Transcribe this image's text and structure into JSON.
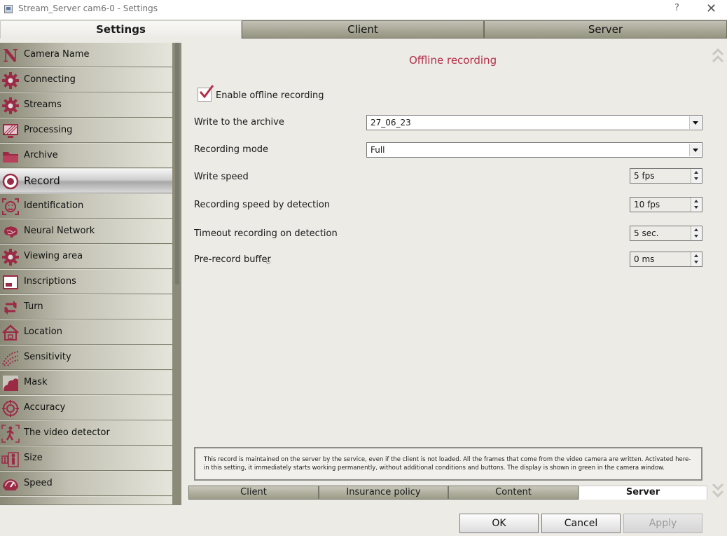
{
  "window": {
    "title": "Stream_Server cam6-0 - Settings",
    "help": "?",
    "close": "✕"
  },
  "top_tabs": [
    {
      "label": "Settings",
      "active": true
    },
    {
      "label": "Client",
      "active": false
    },
    {
      "label": "Server",
      "active": false
    }
  ],
  "sidebar": {
    "items": [
      {
        "label": "Camera Name",
        "icon": "camera-name-icon"
      },
      {
        "label": "Connecting",
        "icon": "gear-icon"
      },
      {
        "label": "Streams",
        "icon": "gear-icon"
      },
      {
        "label": "Processing",
        "icon": "monitor-icon"
      },
      {
        "label": "Archive",
        "icon": "folder-icon"
      },
      {
        "label": "Record",
        "icon": "record-icon",
        "active": true
      },
      {
        "label": "Identification",
        "icon": "face-icon"
      },
      {
        "label": "Neural Network",
        "icon": "brain-icon"
      },
      {
        "label": "Viewing area",
        "icon": "gear-icon"
      },
      {
        "label": "Inscriptions",
        "icon": "inscription-icon"
      },
      {
        "label": "Turn",
        "icon": "rotate-icon"
      },
      {
        "label": "Location",
        "icon": "house-icon"
      },
      {
        "label": "Sensitivity",
        "icon": "sensitivity-icon"
      },
      {
        "label": "Mask",
        "icon": "mask-icon"
      },
      {
        "label": "Accuracy",
        "icon": "target-icon"
      },
      {
        "label": "The video detector",
        "icon": "walking-person-icon"
      },
      {
        "label": "Size",
        "icon": "size-icon"
      },
      {
        "label": "Speed",
        "icon": "speedometer-icon"
      }
    ]
  },
  "main": {
    "heading": "Offline recording",
    "enable_checkbox": {
      "label": "Enable offline recording",
      "checked": true
    },
    "rows": {
      "archive": {
        "label": "Write to the archive",
        "value": "27_06_23"
      },
      "mode": {
        "label": "Recording mode",
        "value": "Full"
      },
      "write_speed": {
        "label": "Write speed",
        "value": "5 fps"
      },
      "detect_speed": {
        "label": "Recording speed by detection",
        "value": "10 fps"
      },
      "timeout": {
        "label": "Timeout recording on detection",
        "value": "5 sec."
      },
      "prerecord": {
        "label": "Pre-record buffer",
        "value": "0 ms"
      }
    },
    "note": "This record is maintained on the server by the service, even if the client is not loaded. All the frames that come from the video camera are written. Activated here-in this setting, it immediately starts working permanently, without additional conditions and buttons. The display is shown in green in the camera window."
  },
  "bottom_tabs": [
    {
      "label": "Client",
      "active": false
    },
    {
      "label": "Insurance policy",
      "active": false
    },
    {
      "label": "Content",
      "active": false
    },
    {
      "label": "Server",
      "active": true
    }
  ],
  "buttons": {
    "ok": "OK",
    "cancel": "Cancel",
    "apply": "Apply"
  },
  "colors": {
    "accent": "#b4304a",
    "icon": "#9b2a45"
  }
}
